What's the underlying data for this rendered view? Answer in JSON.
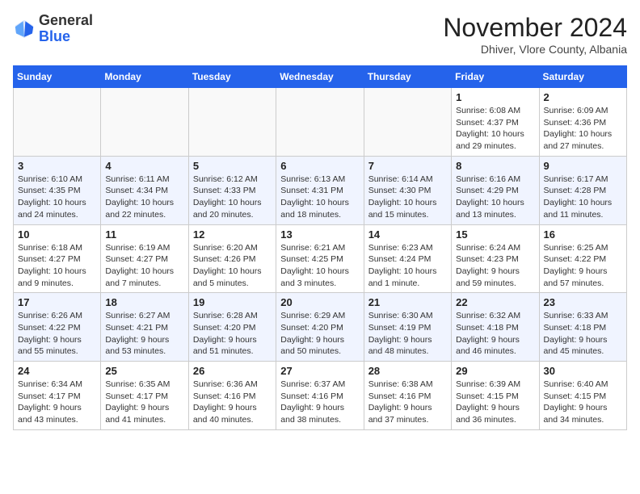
{
  "logo": {
    "general": "General",
    "blue": "Blue"
  },
  "title": "November 2024",
  "subtitle": "Dhiver, Vlore County, Albania",
  "days_of_week": [
    "Sunday",
    "Monday",
    "Tuesday",
    "Wednesday",
    "Thursday",
    "Friday",
    "Saturday"
  ],
  "weeks": [
    [
      {
        "day": "",
        "info": ""
      },
      {
        "day": "",
        "info": ""
      },
      {
        "day": "",
        "info": ""
      },
      {
        "day": "",
        "info": ""
      },
      {
        "day": "",
        "info": ""
      },
      {
        "day": "1",
        "info": "Sunrise: 6:08 AM\nSunset: 4:37 PM\nDaylight: 10 hours and 29 minutes."
      },
      {
        "day": "2",
        "info": "Sunrise: 6:09 AM\nSunset: 4:36 PM\nDaylight: 10 hours and 27 minutes."
      }
    ],
    [
      {
        "day": "3",
        "info": "Sunrise: 6:10 AM\nSunset: 4:35 PM\nDaylight: 10 hours and 24 minutes."
      },
      {
        "day": "4",
        "info": "Sunrise: 6:11 AM\nSunset: 4:34 PM\nDaylight: 10 hours and 22 minutes."
      },
      {
        "day": "5",
        "info": "Sunrise: 6:12 AM\nSunset: 4:33 PM\nDaylight: 10 hours and 20 minutes."
      },
      {
        "day": "6",
        "info": "Sunrise: 6:13 AM\nSunset: 4:31 PM\nDaylight: 10 hours and 18 minutes."
      },
      {
        "day": "7",
        "info": "Sunrise: 6:14 AM\nSunset: 4:30 PM\nDaylight: 10 hours and 15 minutes."
      },
      {
        "day": "8",
        "info": "Sunrise: 6:16 AM\nSunset: 4:29 PM\nDaylight: 10 hours and 13 minutes."
      },
      {
        "day": "9",
        "info": "Sunrise: 6:17 AM\nSunset: 4:28 PM\nDaylight: 10 hours and 11 minutes."
      }
    ],
    [
      {
        "day": "10",
        "info": "Sunrise: 6:18 AM\nSunset: 4:27 PM\nDaylight: 10 hours and 9 minutes."
      },
      {
        "day": "11",
        "info": "Sunrise: 6:19 AM\nSunset: 4:27 PM\nDaylight: 10 hours and 7 minutes."
      },
      {
        "day": "12",
        "info": "Sunrise: 6:20 AM\nSunset: 4:26 PM\nDaylight: 10 hours and 5 minutes."
      },
      {
        "day": "13",
        "info": "Sunrise: 6:21 AM\nSunset: 4:25 PM\nDaylight: 10 hours and 3 minutes."
      },
      {
        "day": "14",
        "info": "Sunrise: 6:23 AM\nSunset: 4:24 PM\nDaylight: 10 hours and 1 minute."
      },
      {
        "day": "15",
        "info": "Sunrise: 6:24 AM\nSunset: 4:23 PM\nDaylight: 9 hours and 59 minutes."
      },
      {
        "day": "16",
        "info": "Sunrise: 6:25 AM\nSunset: 4:22 PM\nDaylight: 9 hours and 57 minutes."
      }
    ],
    [
      {
        "day": "17",
        "info": "Sunrise: 6:26 AM\nSunset: 4:22 PM\nDaylight: 9 hours and 55 minutes."
      },
      {
        "day": "18",
        "info": "Sunrise: 6:27 AM\nSunset: 4:21 PM\nDaylight: 9 hours and 53 minutes."
      },
      {
        "day": "19",
        "info": "Sunrise: 6:28 AM\nSunset: 4:20 PM\nDaylight: 9 hours and 51 minutes."
      },
      {
        "day": "20",
        "info": "Sunrise: 6:29 AM\nSunset: 4:20 PM\nDaylight: 9 hours and 50 minutes."
      },
      {
        "day": "21",
        "info": "Sunrise: 6:30 AM\nSunset: 4:19 PM\nDaylight: 9 hours and 48 minutes."
      },
      {
        "day": "22",
        "info": "Sunrise: 6:32 AM\nSunset: 4:18 PM\nDaylight: 9 hours and 46 minutes."
      },
      {
        "day": "23",
        "info": "Sunrise: 6:33 AM\nSunset: 4:18 PM\nDaylight: 9 hours and 45 minutes."
      }
    ],
    [
      {
        "day": "24",
        "info": "Sunrise: 6:34 AM\nSunset: 4:17 PM\nDaylight: 9 hours and 43 minutes."
      },
      {
        "day": "25",
        "info": "Sunrise: 6:35 AM\nSunset: 4:17 PM\nDaylight: 9 hours and 41 minutes."
      },
      {
        "day": "26",
        "info": "Sunrise: 6:36 AM\nSunset: 4:16 PM\nDaylight: 9 hours and 40 minutes."
      },
      {
        "day": "27",
        "info": "Sunrise: 6:37 AM\nSunset: 4:16 PM\nDaylight: 9 hours and 38 minutes."
      },
      {
        "day": "28",
        "info": "Sunrise: 6:38 AM\nSunset: 4:16 PM\nDaylight: 9 hours and 37 minutes."
      },
      {
        "day": "29",
        "info": "Sunrise: 6:39 AM\nSunset: 4:15 PM\nDaylight: 9 hours and 36 minutes."
      },
      {
        "day": "30",
        "info": "Sunrise: 6:40 AM\nSunset: 4:15 PM\nDaylight: 9 hours and 34 minutes."
      }
    ]
  ]
}
